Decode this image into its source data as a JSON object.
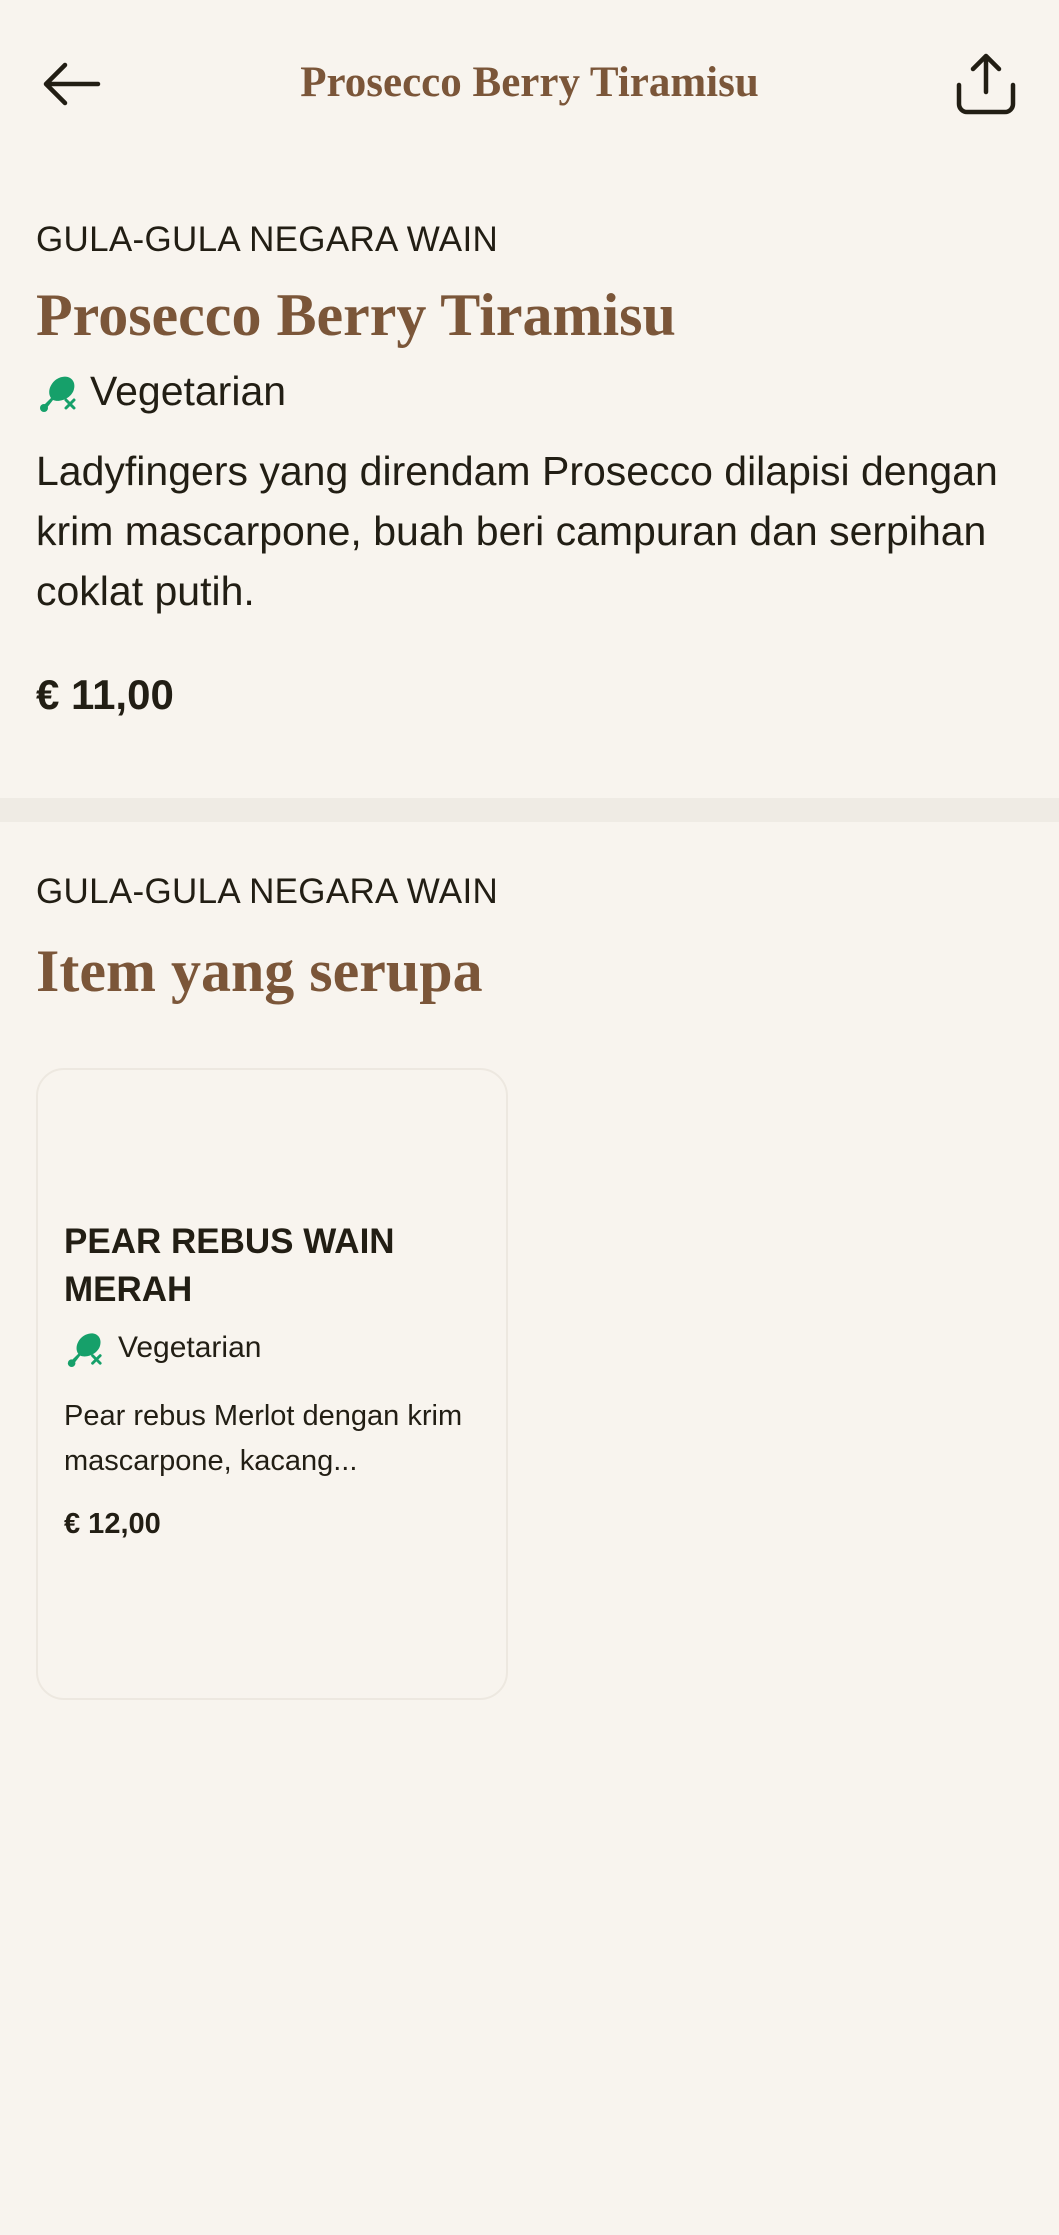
{
  "header": {
    "title": "Prosecco Berry Tiramisu",
    "back_icon": "arrow-left-icon",
    "share_icon": "share-icon"
  },
  "item": {
    "category": "GULA-GULA NEGARA WAIN",
    "name": "Prosecco Berry Tiramisu",
    "diet_label": "Vegetarian",
    "description": "Ladyfingers yang direndam Prosecco dilapisi dengan krim mascarpone, buah beri campuran dan serpihan coklat putih.",
    "price": "€ 11,00"
  },
  "similar": {
    "category": "GULA-GULA NEGARA WAIN",
    "heading": "Item yang serupa",
    "items": [
      {
        "name": "PEAR REBUS WAIN MERAH",
        "diet_label": "Vegetarian",
        "description": "Pear rebus Merlot dengan krim mascarpone, kacang...",
        "price": "€ 12,00"
      }
    ]
  },
  "colors": {
    "background": "#f8f4ee",
    "accent_brown": "#7b5639",
    "text": "#221e14",
    "veg_green": "#16a06a"
  }
}
